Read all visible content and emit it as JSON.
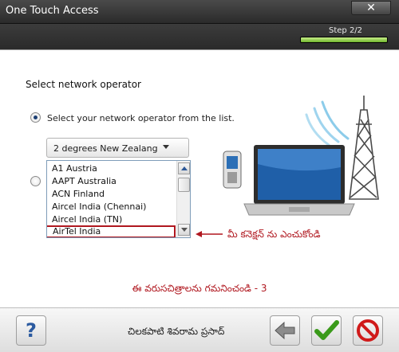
{
  "window": {
    "title": "One Touch Access",
    "close_glyph": "✕"
  },
  "stepper": {
    "label": "Step 2/2",
    "progress_fraction": 1.0
  },
  "page": {
    "heading": "Select network operator",
    "radio_select_label": "Select your network operator from the list.",
    "radio_other_label_partial": "t"
  },
  "dropdown": {
    "selected_value": "2 degrees New Zealang"
  },
  "operator_list": {
    "items": [
      "A1 Austria",
      "AAPT Australia",
      "ACN Finland",
      "Aircel India (Chennai)",
      "Aircel India (TN)",
      "AirTel India"
    ],
    "selected_item": "AirTel India"
  },
  "annotations": {
    "arrow_text": "మీ కనెక్షన్ ను ఎంచుకోండి",
    "caption": "ఈ వరుసచిత్రాలను గమనించండి - 3",
    "credit": "చిలకపాటి శివరామ ప్రసాద్"
  },
  "footer": {
    "help_glyph": "?"
  },
  "colors": {
    "accent_red": "#b0171f",
    "progress_green": "#6fb52c",
    "help_blue": "#2b5aa0",
    "ok_green": "#3a9a1a",
    "cancel_red": "#d01a1a"
  },
  "icons": [
    "close-icon",
    "radio-selected-icon",
    "radio-unselected-icon",
    "chevron-down-icon",
    "scroll-up-icon",
    "scroll-down-icon",
    "cell-tower-icon",
    "laptop-icon",
    "mobile-phone-icon",
    "wireless-signal-icon",
    "left-arrow-icon",
    "help-icon",
    "back-arrow-icon",
    "checkmark-icon",
    "cancel-icon"
  ]
}
